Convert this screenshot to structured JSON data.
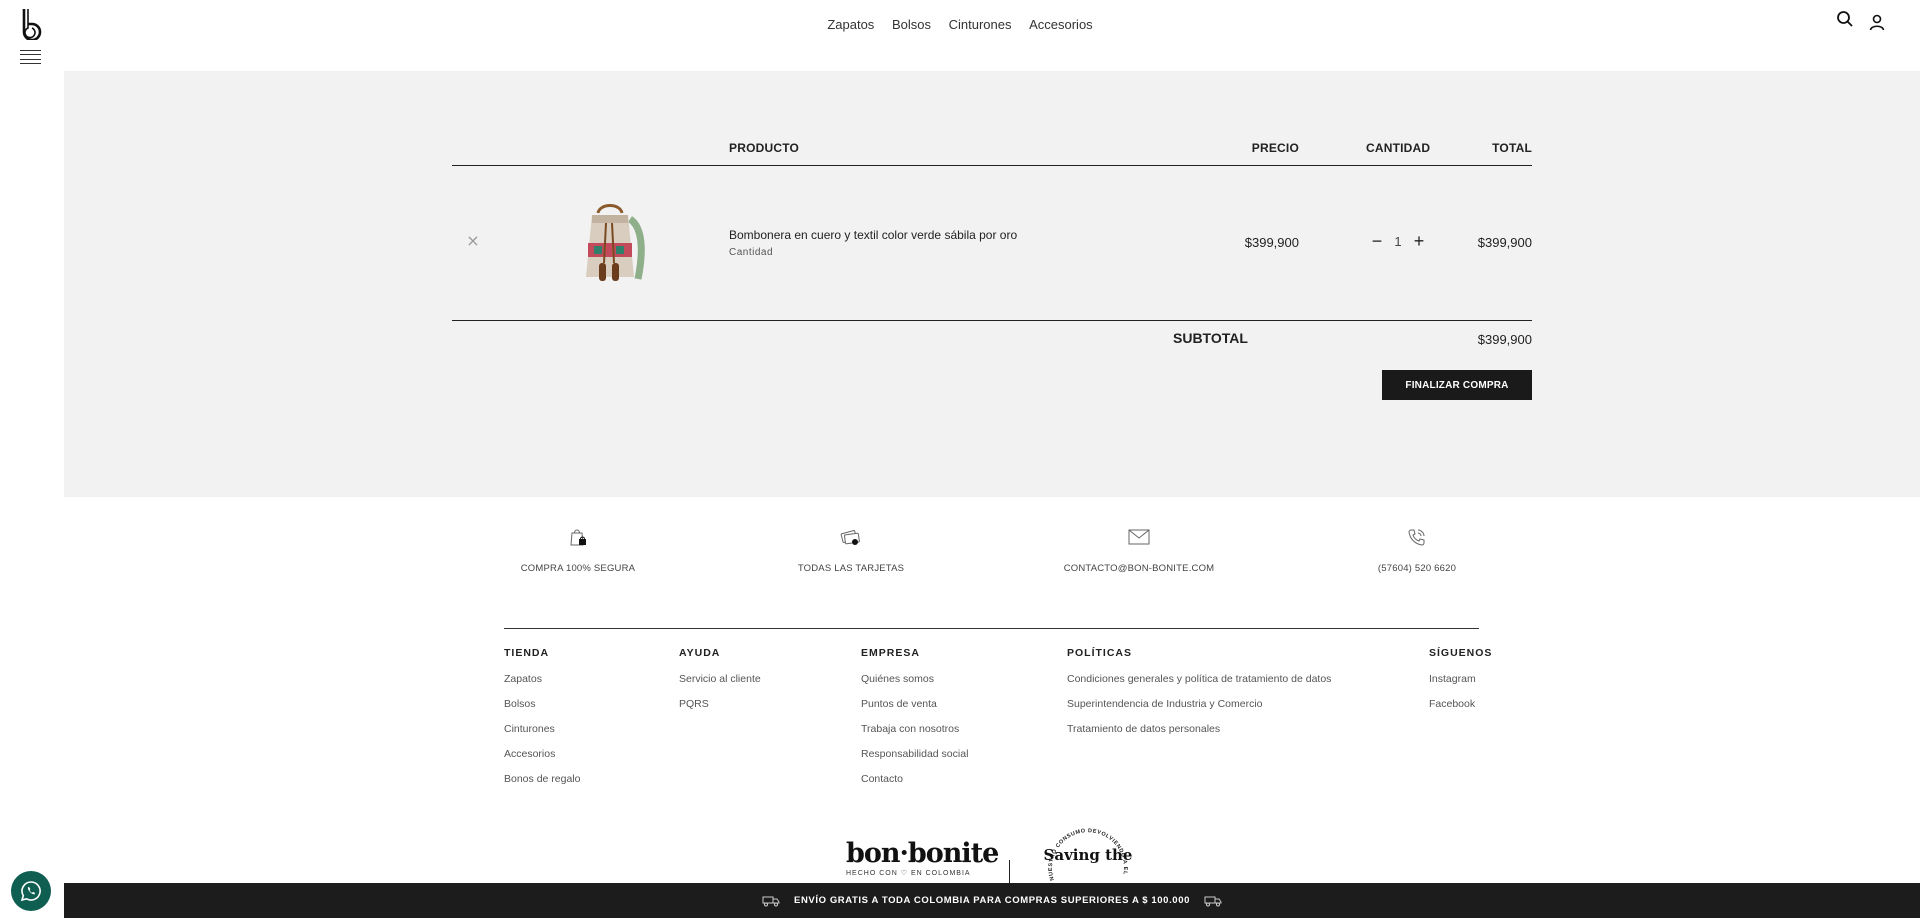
{
  "header": {
    "nav": [
      "Zapatos",
      "Bolsos",
      "Cinturones",
      "Accesorios"
    ]
  },
  "cart": {
    "columns": {
      "product": "PRODUCTO",
      "price": "PRECIO",
      "quantity": "CANTIDAD",
      "total": "TOTAL"
    },
    "item": {
      "name": "Bombonera en cuero y textil color verde sábila por oro",
      "sub": "Cantidad",
      "price": "$399,900",
      "quantity": "1",
      "total": "$399,900",
      "remove_symbol": "×",
      "minus_symbol": "−",
      "plus_symbol": "+"
    },
    "subtotal_label": "SUBTOTAL",
    "subtotal_value": "$399,900",
    "checkout_label": "FINALIZAR COMPRA"
  },
  "badges": [
    {
      "icon": "shopping-bag-lock-icon",
      "label": "COMPRA 100% SEGURA"
    },
    {
      "icon": "credit-cards-icon",
      "label": "TODAS LAS TARJETAS"
    },
    {
      "icon": "envelope-icon",
      "label": "CONTACTO@BON-BONITE.COM"
    },
    {
      "icon": "phone-icon",
      "label": "(57604) 520 6620"
    }
  ],
  "footer": {
    "tienda": {
      "title": "TIENDA",
      "links": [
        "Zapatos",
        "Bolsos",
        "Cinturones",
        "Accesorios",
        "Bonos de regalo"
      ]
    },
    "ayuda": {
      "title": "AYUDA",
      "links": [
        "Servicio al cliente",
        "PQRS"
      ]
    },
    "empresa": {
      "title": "EMPRESA",
      "links": [
        "Quiénes somos",
        "Puntos de venta",
        "Trabaja con nosotros",
        "Responsabilidad social",
        "Contacto"
      ]
    },
    "politicas": {
      "title": "POLÍTICAS",
      "links": [
        "Condiciones generales y política de tratamiento de datos",
        "Superintendencia de Industria y Comercio",
        "Tratamiento de datos personales"
      ]
    },
    "siguenos": {
      "title": "SÍGUENOS",
      "links": [
        "Instagram",
        "Facebook"
      ]
    },
    "brand_name": "bon·bonite",
    "brand_tagline": "HECHO CON ♡ EN COLOMBIA",
    "seal_text": "Saving the",
    "seal_ring_text": "NUESTRO CONSUMO DEVOLVIENDO A EL"
  },
  "bottom_bar": {
    "text": "ENVÍO GRATIS A TODA COLOMBIA PARA COMPRAS SUPERIORES A $ 100.000"
  },
  "colors": {
    "cart_bg": "#f2f2f2",
    "dark": "#1a1a1a",
    "whatsapp": "#0f5e52"
  }
}
